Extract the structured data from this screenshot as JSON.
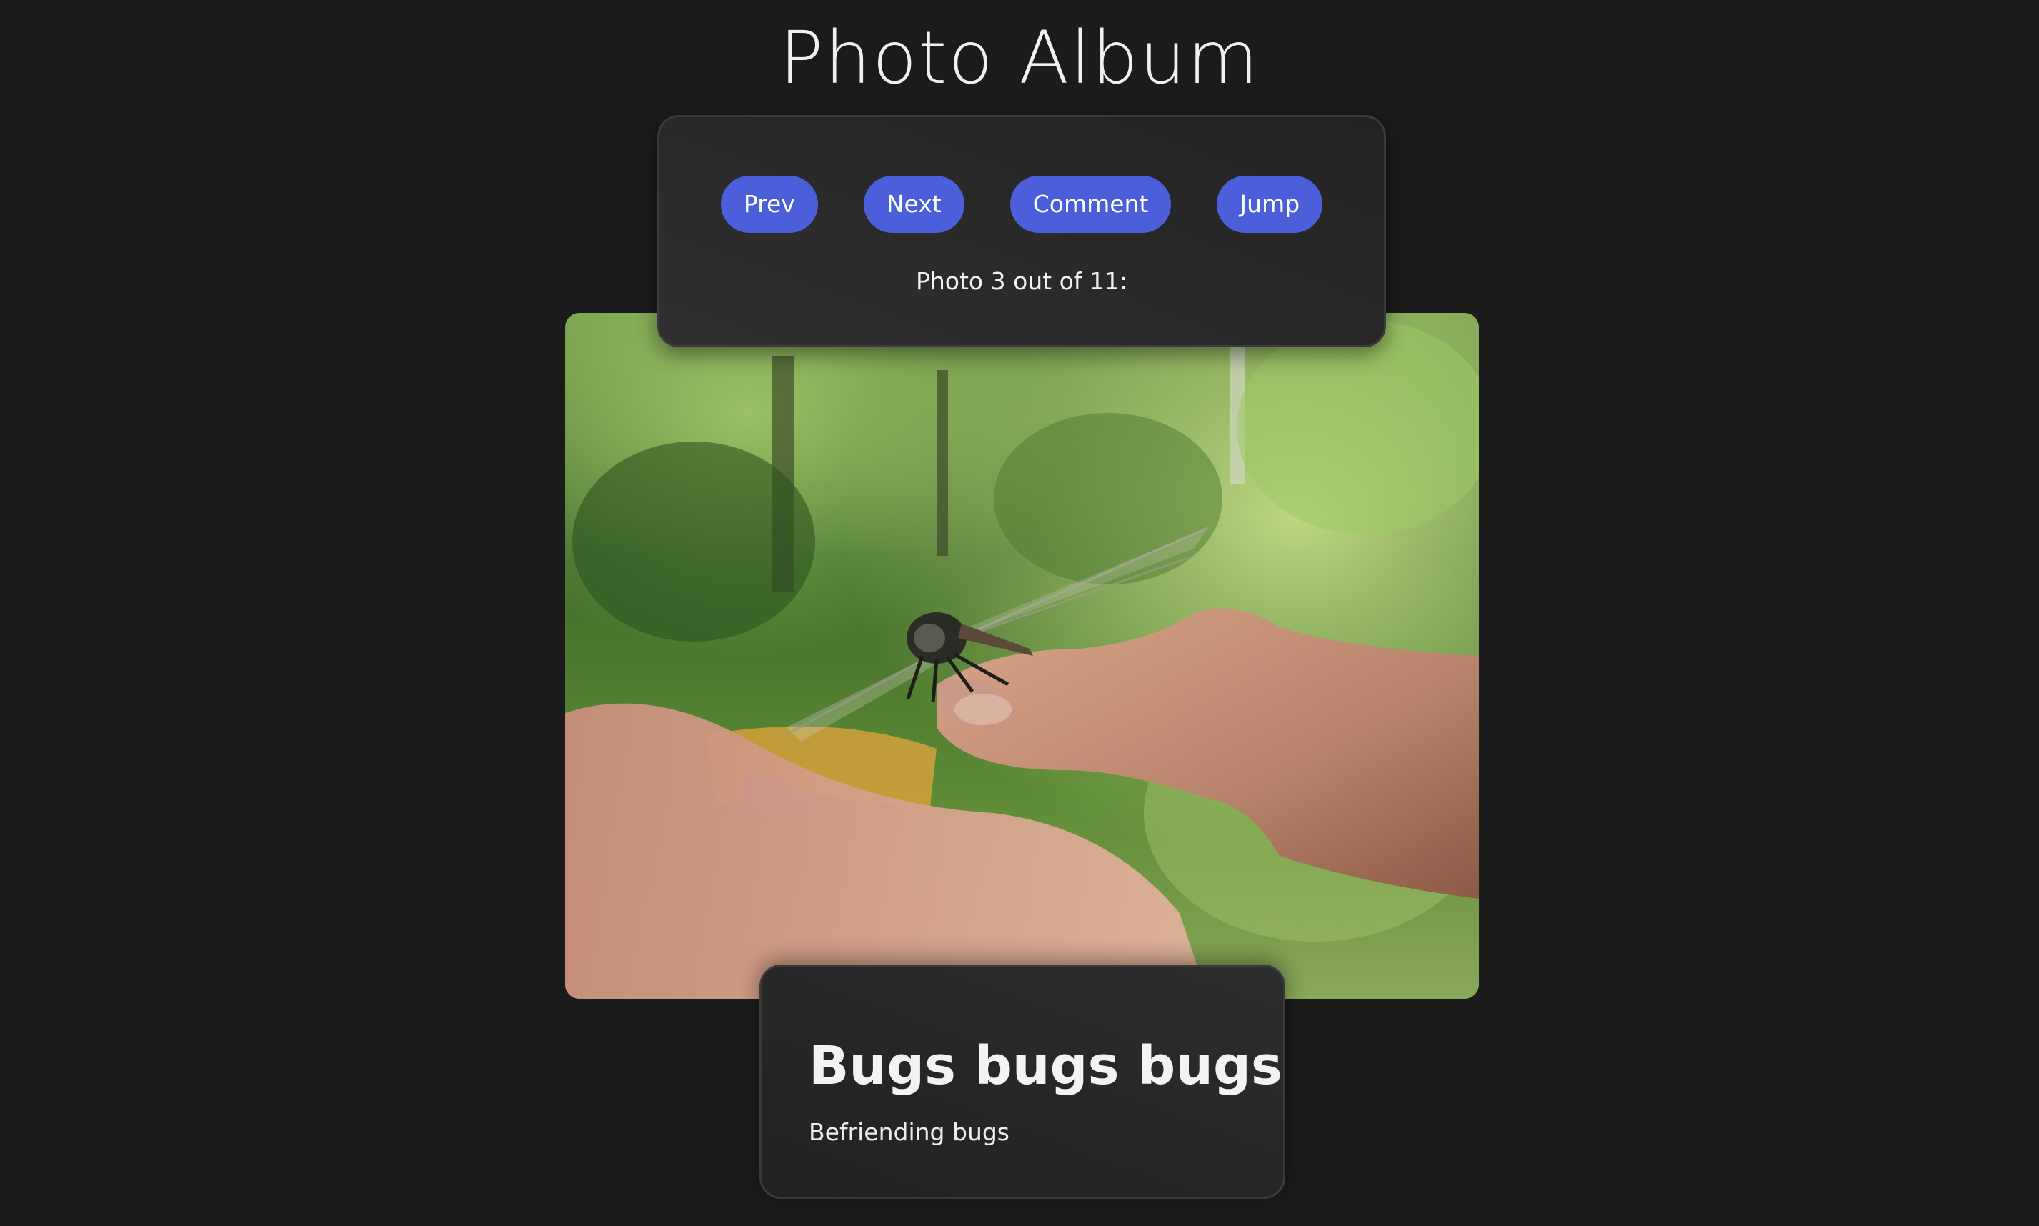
{
  "app": {
    "title": "Photo Album"
  },
  "controls": {
    "buttons": [
      {
        "label": "Prev"
      },
      {
        "label": "Next"
      },
      {
        "label": "Comment"
      },
      {
        "label": "Jump"
      }
    ],
    "counter_text": "Photo 3 out of 11:"
  },
  "photo": {
    "current_index": 3,
    "total": 11
  },
  "caption": {
    "title": "Bugs bugs bugs",
    "description": "Befriending bugs"
  },
  "colors": {
    "background": "#1b1b1b",
    "button": "#4b5fdb",
    "card": "#262626"
  }
}
